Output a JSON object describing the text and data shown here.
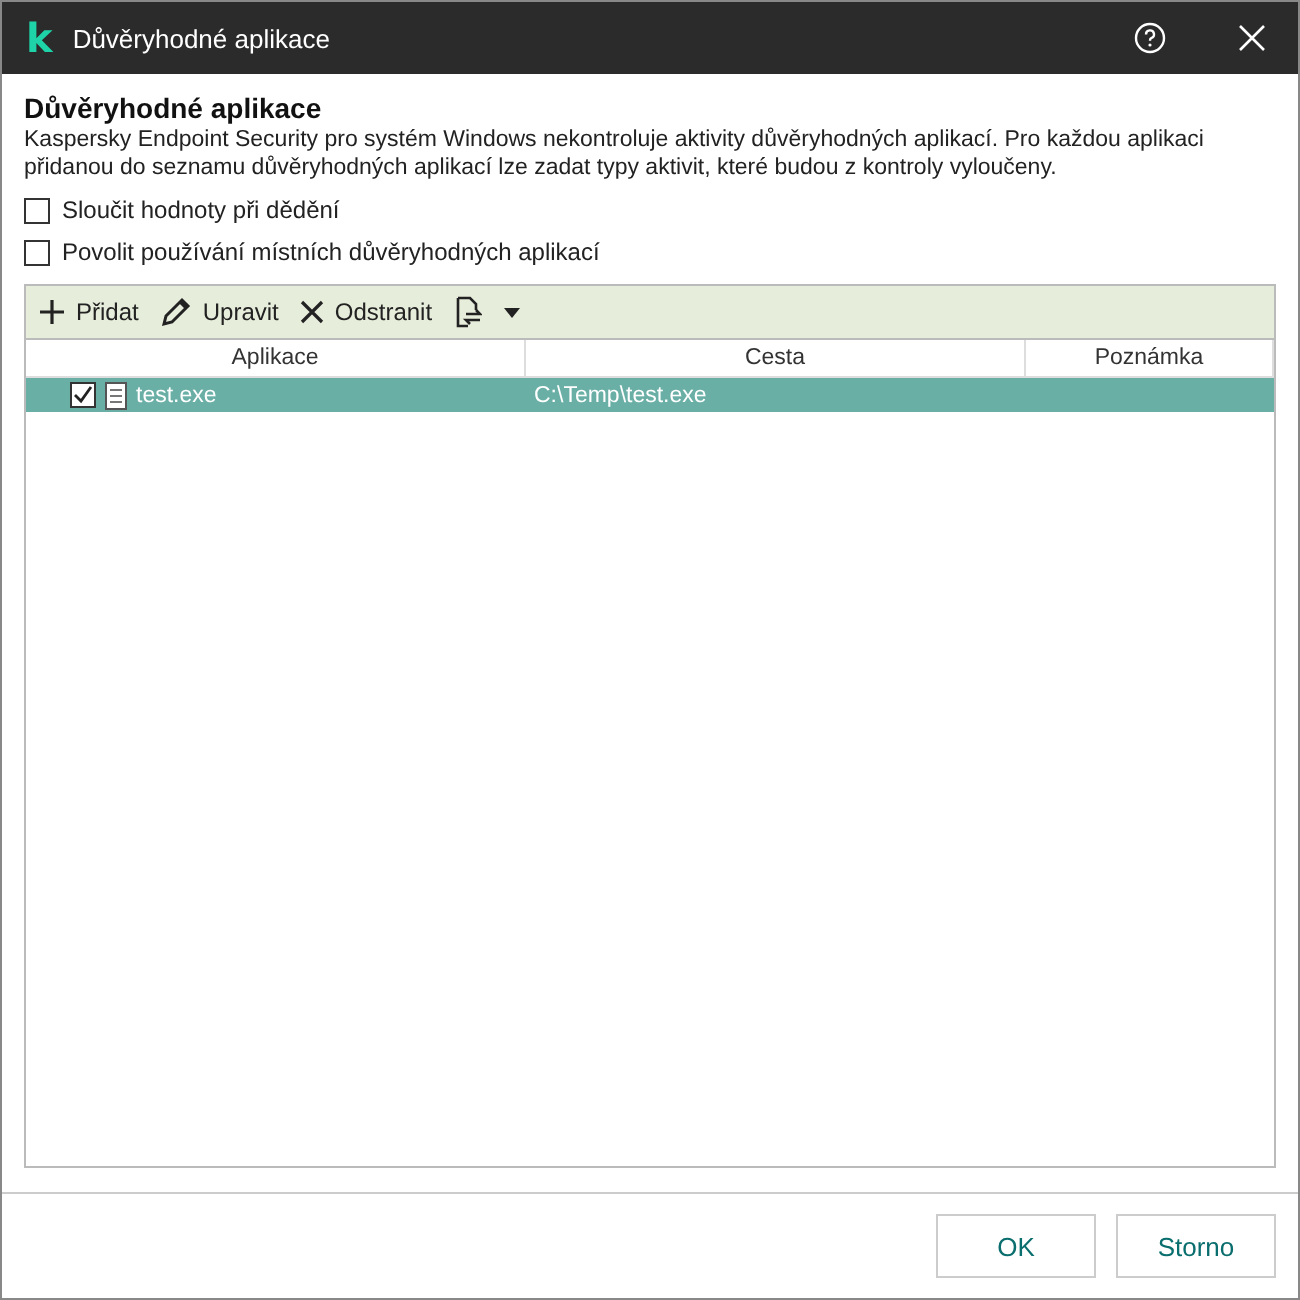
{
  "window": {
    "logo": "k",
    "title": "Důvěryhodné aplikace"
  },
  "heading": "Důvěryhodné aplikace",
  "description": "Kaspersky Endpoint Security pro systém Windows nekontroluje aktivity důvěryhodných aplikací. Pro každou aplikaci přidanou do seznamu důvěryhodných aplikací lze zadat typy aktivit, které budou z kontroly vyloučeny.",
  "options": [
    {
      "label": "Sloučit hodnoty při dědění",
      "checked": false
    },
    {
      "label": "Povolit používání místních důvěryhodných aplikací",
      "checked": false
    }
  ],
  "toolbar": [
    {
      "kind": "add",
      "label": "Přidat"
    },
    {
      "kind": "edit",
      "label": "Upravit"
    },
    {
      "kind": "remove",
      "label": "Odstranit"
    },
    {
      "kind": "import"
    }
  ],
  "table": {
    "columns": [
      "Aplikace",
      "Cesta",
      "Poznámka"
    ],
    "rows": [
      {
        "checked": true,
        "selected": true,
        "cells": [
          "test.exe",
          "C:\\Temp\\test.exe",
          ""
        ]
      }
    ]
  },
  "buttons": [
    "OK",
    "Storno"
  ]
}
